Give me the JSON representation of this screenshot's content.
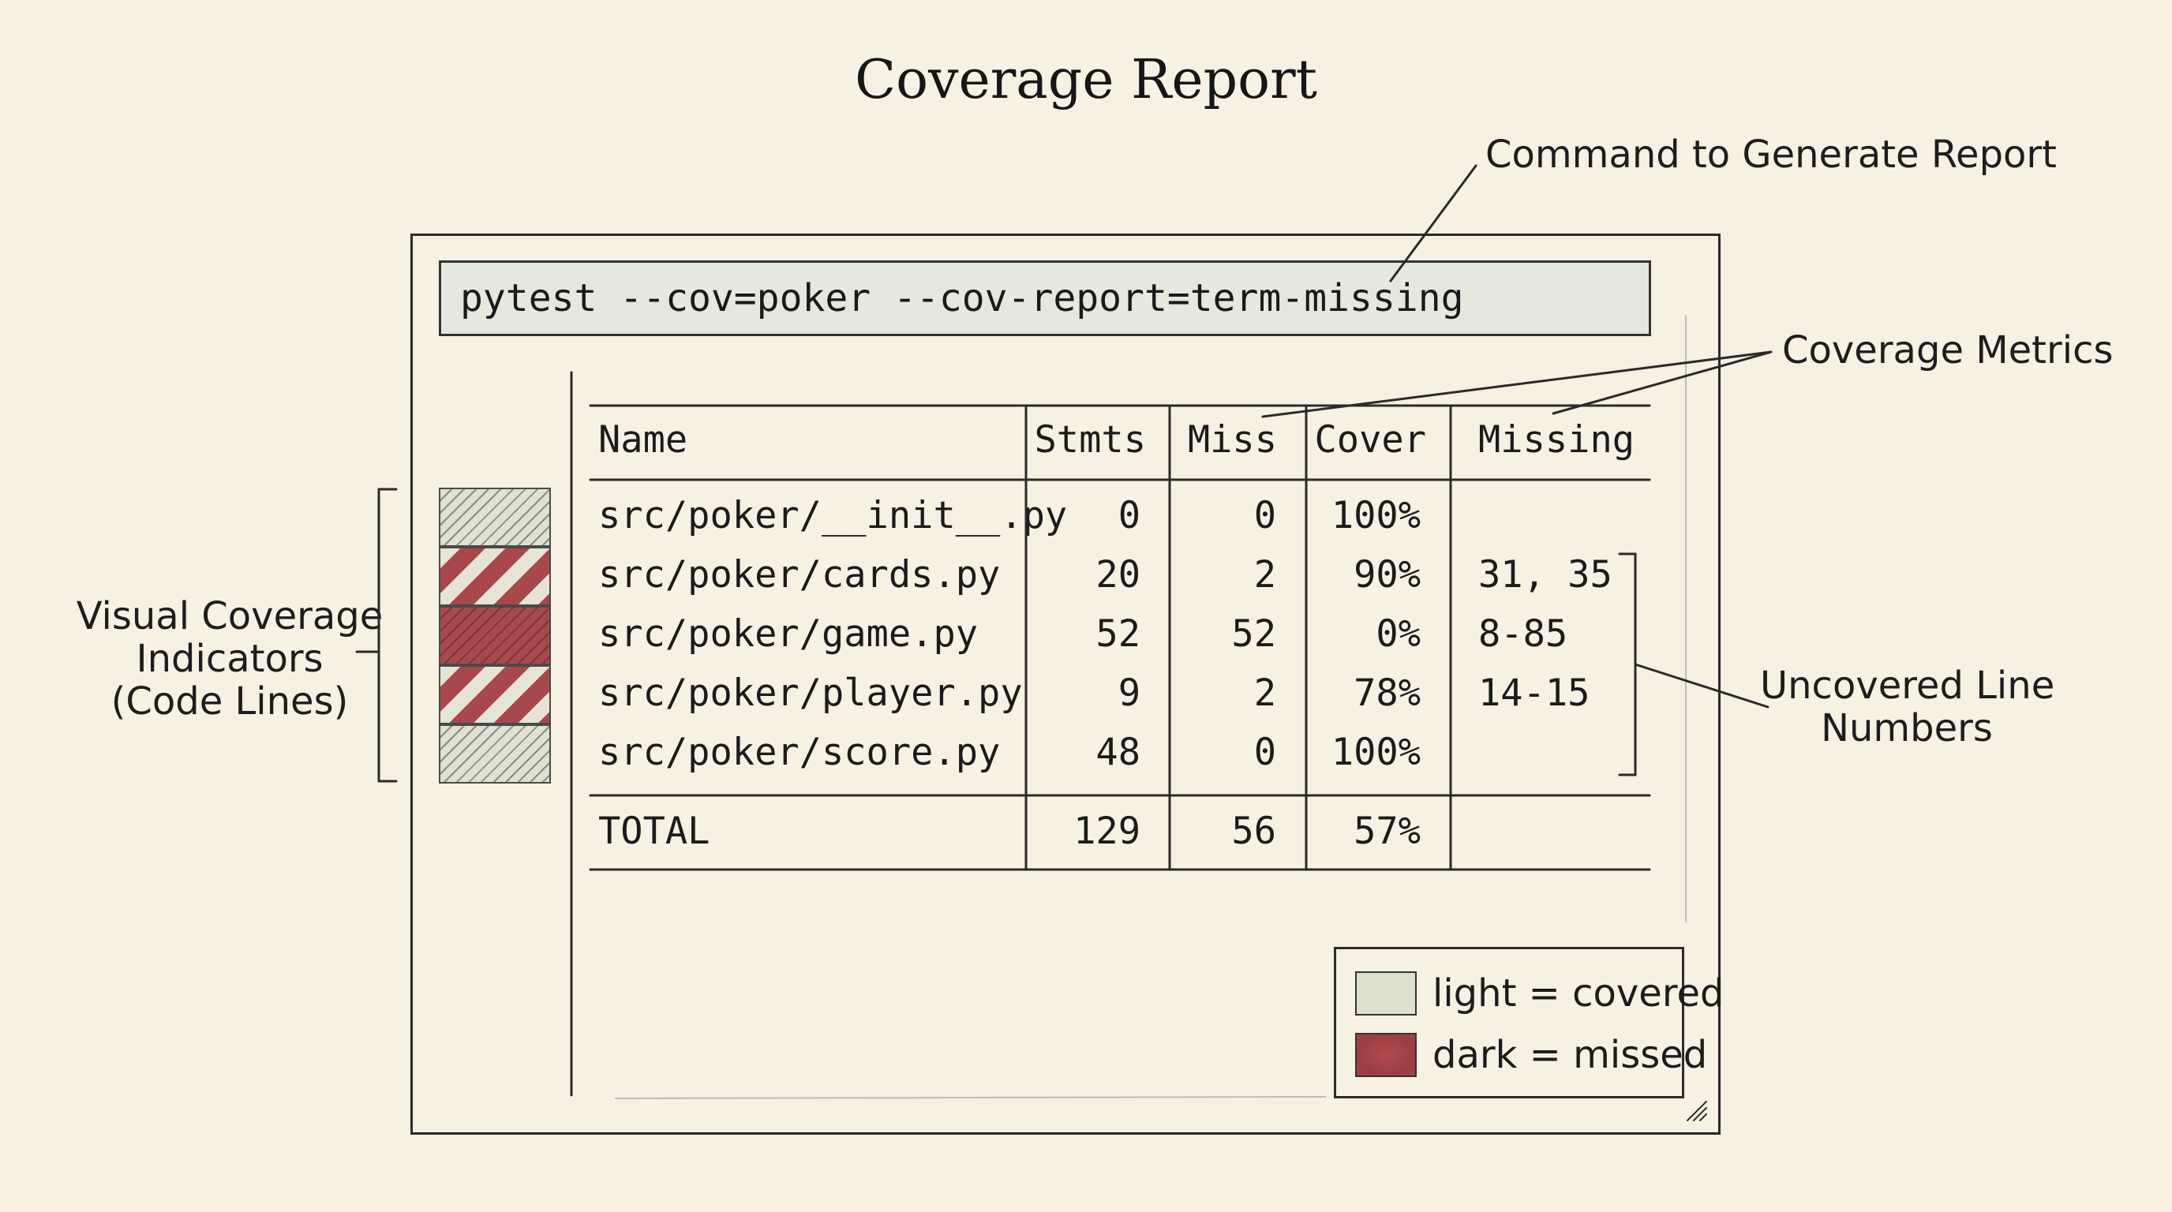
{
  "title": "Coverage Report",
  "callouts": {
    "command": "Command to Generate Report",
    "metrics": "Coverage Metrics",
    "uncovered_line1": "Uncovered Line",
    "uncovered_line2": "Numbers",
    "visual_line1": "Visual Coverage",
    "visual_line2": "Indicators",
    "visual_line3": "(Code Lines)"
  },
  "command": "pytest --cov=poker --cov-report=term-missing",
  "table": {
    "headers": [
      "Name",
      "Stmts",
      "Miss",
      "Cover",
      "Missing"
    ],
    "rows": [
      {
        "name": "src/poker/__init__.py",
        "stmts": "0",
        "miss": "0",
        "cover": "100%",
        "missing": ""
      },
      {
        "name": "src/poker/cards.py",
        "stmts": "20",
        "miss": "2",
        "cover": "90%",
        "missing": "31, 35"
      },
      {
        "name": "src/poker/game.py",
        "stmts": "52",
        "miss": "52",
        "cover": "0%",
        "missing": "8-85"
      },
      {
        "name": "src/poker/player.py",
        "stmts": "9",
        "miss": "2",
        "cover": "78%",
        "missing": "14-15"
      },
      {
        "name": "src/poker/score.py",
        "stmts": "48",
        "miss": "0",
        "cover": "100%",
        "missing": ""
      }
    ],
    "total": {
      "name": "TOTAL",
      "stmts": "129",
      "miss": "56",
      "cover": "57%",
      "missing": ""
    }
  },
  "indicators": [
    "light",
    "mixed",
    "dark",
    "mixed",
    "light"
  ],
  "legend": {
    "light_label": "light = covered",
    "dark_label": "dark = missed"
  },
  "colors": {
    "background": "#f7f1e3",
    "covered": "#dde0cf",
    "missed": "#a44a4d"
  }
}
